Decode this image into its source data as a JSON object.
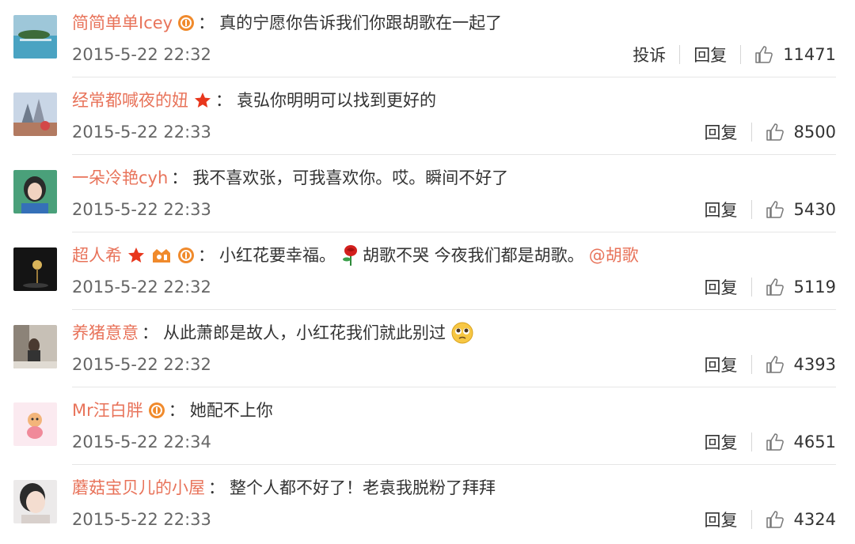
{
  "comments": [
    {
      "name": "简简单单Icey",
      "badges": [
        "vip-badge-icon"
      ],
      "text": "真的宁愿你告诉我们你跟胡歌在一起了",
      "time": "2015-5-22 22:32",
      "actions": [
        "投诉",
        "回复"
      ],
      "likes": "11471",
      "avatar_icon": "seascape-avatar-icon"
    },
    {
      "name": "经常都喊夜的妞",
      "badges": [
        "star-badge-icon"
      ],
      "text": "袁弘你明明可以找到更好的",
      "time": "2015-5-22 22:33",
      "actions": [
        "回复"
      ],
      "likes": "8500",
      "avatar_icon": "castle-avatar-icon"
    },
    {
      "name": "一朵冷艳cyh",
      "badges": [],
      "text": "我不喜欢张，可我喜欢你。哎。瞬间不好了",
      "time": "2015-5-22 22:33",
      "actions": [
        "回复"
      ],
      "likes": "5430",
      "avatar_icon": "girl-avatar-icon"
    },
    {
      "name": "超人希",
      "badges": [
        "star-badge-icon",
        "member-badge-icon",
        "vip-badge-icon"
      ],
      "text": "小红花要幸福。",
      "emoji": "rose-emoji-icon",
      "text2": "胡歌不哭 今夜我们都是胡歌。",
      "mention": "@胡歌",
      "time": "2015-5-22 22:32",
      "actions": [
        "回复"
      ],
      "likes": "5119",
      "avatar_icon": "dark-avatar-icon"
    },
    {
      "name": "养猪意意",
      "badges": [],
      "text": "从此萧郎是故人，小红花我们就此别过",
      "emoji_after": "pleading-face-emoji-icon",
      "time": "2015-5-22 22:32",
      "actions": [
        "回复"
      ],
      "likes": "4393",
      "avatar_icon": "room-avatar-icon"
    },
    {
      "name": "Mr汪白胖",
      "badges": [
        "vip-badge-icon"
      ],
      "text": "她配不上你",
      "time": "2015-5-22 22:34",
      "actions": [
        "回复"
      ],
      "likes": "4651",
      "avatar_icon": "cartoon-avatar-icon"
    },
    {
      "name": "蘑菇宝贝儿的小屋",
      "badges": [],
      "text": "整个人都不好了！老袁我脱粉了拜拜",
      "time": "2015-5-22 22:33",
      "actions": [
        "回复"
      ],
      "likes": "4324",
      "avatar_icon": "face-avatar-icon"
    }
  ],
  "colors": {
    "name": "#e8735a",
    "text": "#333333",
    "time": "#666666",
    "divider": "#e6e6e6",
    "badge_orange": "#f08a2c",
    "star_red": "#e8361c"
  },
  "icons": {
    "like": "thumbs-up-icon"
  }
}
